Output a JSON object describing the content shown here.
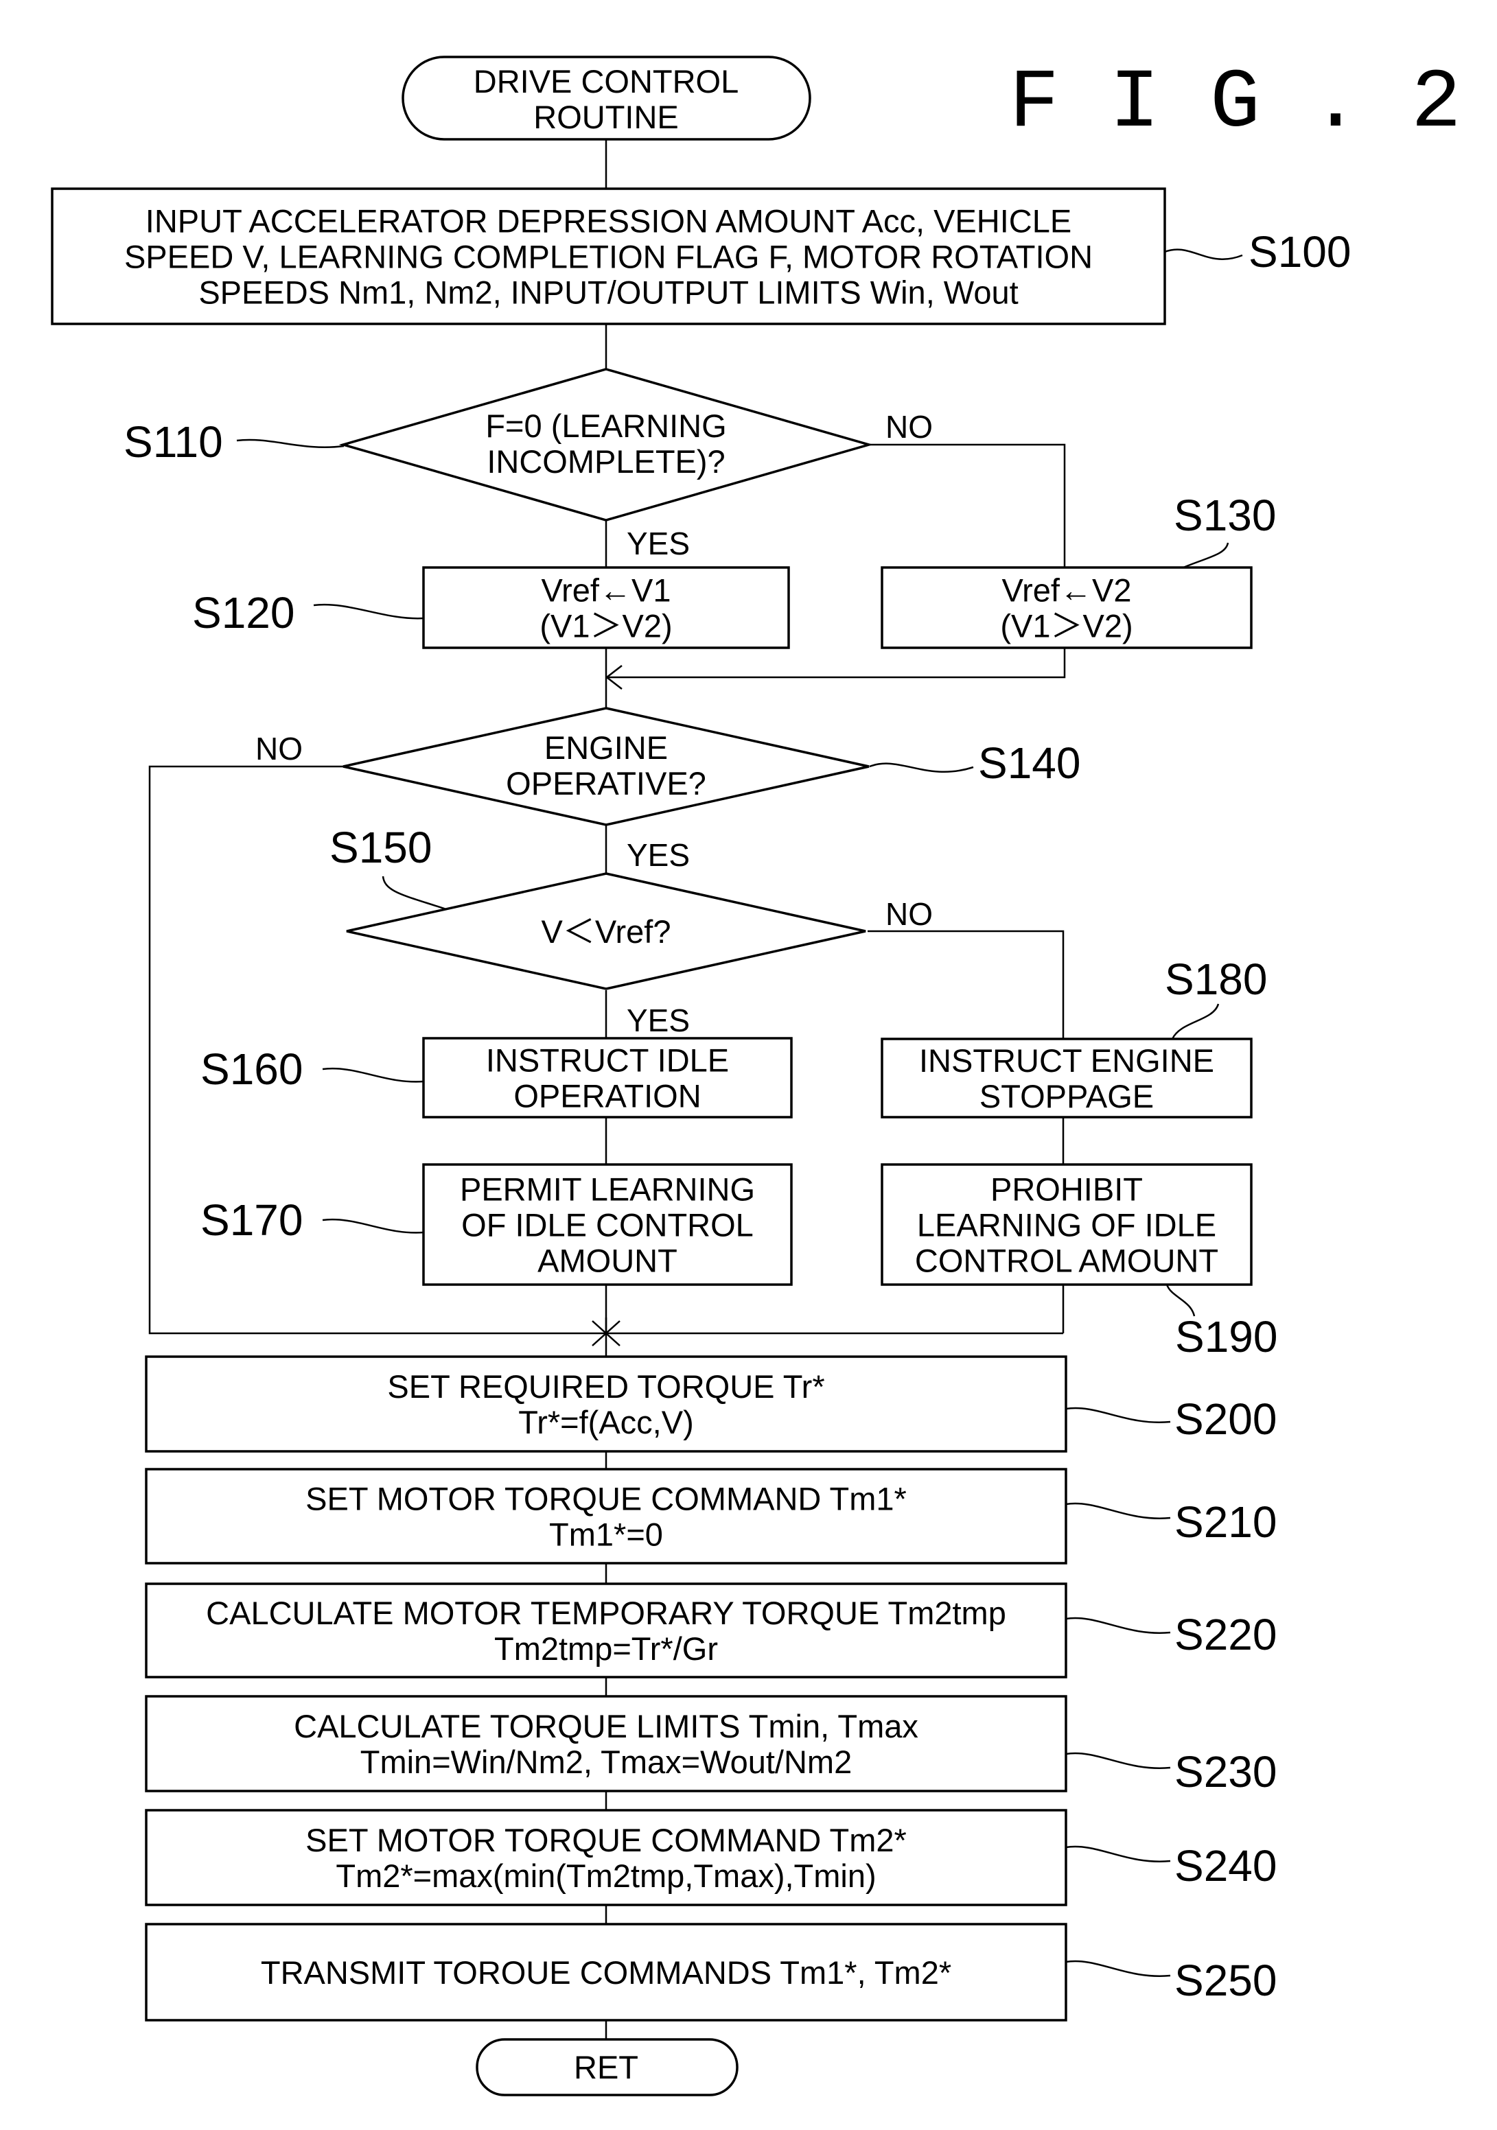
{
  "figure": {
    "title": "F I G . 2",
    "ink_color": "#000000",
    "paper_color": "#ffffff"
  },
  "terminals": {
    "start": {
      "lines": [
        "DRIVE CONTROL",
        "ROUTINE"
      ]
    },
    "end": {
      "lines": [
        "RET"
      ]
    }
  },
  "steps": [
    {
      "id": "S100",
      "type": "process",
      "label": "S100",
      "lines": [
        "INPUT ACCELERATOR DEPRESSION AMOUNT Acc, VEHICLE",
        "SPEED V, LEARNING COMPLETION FLAG F, MOTOR ROTATION",
        "SPEEDS Nm1, Nm2, INPUT/OUTPUT LIMITS Win, Wout"
      ]
    },
    {
      "id": "S110",
      "type": "decision",
      "label": "S110",
      "lines": [
        "F=0 (LEARNING",
        "INCOMPLETE)?"
      ],
      "yes_label": "YES",
      "no_label": "NO"
    },
    {
      "id": "S120",
      "type": "process",
      "label": "S120",
      "lines": [
        "Vref←V1",
        "(V1＞V2)"
      ]
    },
    {
      "id": "S130",
      "type": "process",
      "label": "S130",
      "lines": [
        "Vref←V2",
        "(V1＞V2)"
      ]
    },
    {
      "id": "S140",
      "type": "decision",
      "label": "S140",
      "lines": [
        "ENGINE",
        "OPERATIVE?"
      ],
      "yes_label": "YES",
      "no_label": "NO"
    },
    {
      "id": "S150",
      "type": "decision",
      "label": "S150",
      "lines": [
        "V＜Vref?"
      ],
      "yes_label": "YES",
      "no_label": "NO"
    },
    {
      "id": "S160",
      "type": "process",
      "label": "S160",
      "lines": [
        "INSTRUCT IDLE",
        "OPERATION"
      ]
    },
    {
      "id": "S170",
      "type": "process",
      "label": "S170",
      "lines": [
        "PERMIT LEARNING",
        "OF IDLE CONTROL",
        "AMOUNT"
      ]
    },
    {
      "id": "S180",
      "type": "process",
      "label": "S180",
      "lines": [
        "INSTRUCT ENGINE",
        "STOPPAGE"
      ]
    },
    {
      "id": "S190",
      "type": "process",
      "label": "S190",
      "lines": [
        "PROHIBIT",
        "LEARNING OF IDLE",
        "CONTROL AMOUNT"
      ]
    },
    {
      "id": "S200",
      "type": "process",
      "label": "S200",
      "lines": [
        "SET REQUIRED TORQUE Tr*",
        "Tr*=f(Acc,V)"
      ]
    },
    {
      "id": "S210",
      "type": "process",
      "label": "S210",
      "lines": [
        "SET MOTOR TORQUE COMMAND Tm1*",
        "Tm1*=0"
      ]
    },
    {
      "id": "S220",
      "type": "process",
      "label": "S220",
      "lines": [
        "CALCULATE MOTOR TEMPORARY TORQUE Tm2tmp",
        "Tm2tmp=Tr*/Gr"
      ]
    },
    {
      "id": "S230",
      "type": "process",
      "label": "S230",
      "lines": [
        "CALCULATE TORQUE LIMITS Tmin, Tmax",
        "Tmin=Win/Nm2, Tmax=Wout/Nm2"
      ]
    },
    {
      "id": "S240",
      "type": "process",
      "label": "S240",
      "lines": [
        "SET MOTOR TORQUE COMMAND Tm2*",
        "Tm2*=max(min(Tm2tmp,Tmax),Tmin)"
      ]
    },
    {
      "id": "S250",
      "type": "process",
      "label": "S250",
      "lines": [
        "TRANSMIT TOROUE COMMANDS Tm1*, Tm2*"
      ]
    }
  ]
}
